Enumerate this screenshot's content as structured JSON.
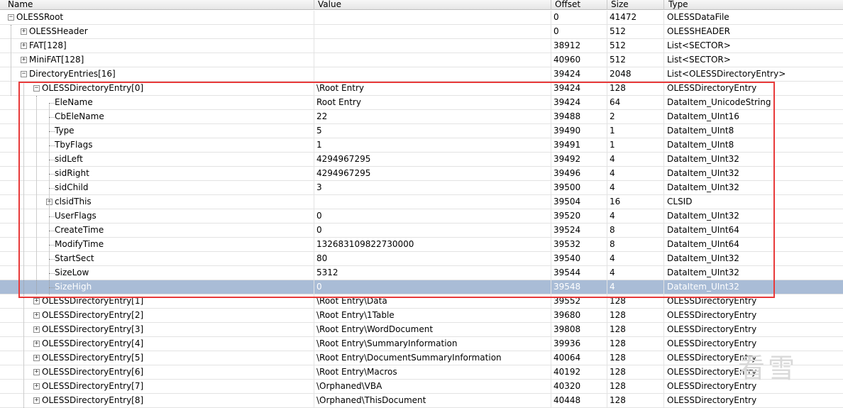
{
  "columns": {
    "name": "Name",
    "value": "Value",
    "offset": "Offset",
    "size": "Size",
    "type": "Type"
  },
  "rows": [
    {
      "name": "OLESSRoot",
      "value": "",
      "offset": "0",
      "size": "41472",
      "type": "OLESSDataFile",
      "level": 0,
      "expander": "-"
    },
    {
      "name": "OLESSHeader",
      "value": "",
      "offset": "0",
      "size": "512",
      "type": "OLESSHEADER",
      "level": 1,
      "expander": "+"
    },
    {
      "name": "FAT[128]",
      "value": "",
      "offset": "38912",
      "size": "512",
      "type": "List<SECTOR>",
      "level": 1,
      "expander": "+"
    },
    {
      "name": "MiniFAT[128]",
      "value": "",
      "offset": "40960",
      "size": "512",
      "type": "List<SECTOR>",
      "level": 1,
      "expander": "+"
    },
    {
      "name": "DirectoryEntries[16]",
      "value": "",
      "offset": "39424",
      "size": "2048",
      "type": "List<OLESSDirectoryEntry>",
      "level": 1,
      "expander": "-"
    },
    {
      "name": "OLESSDirectoryEntry[0]",
      "value": "\\Root Entry",
      "offset": "39424",
      "size": "128",
      "type": "OLESSDirectoryEntry",
      "level": 2,
      "expander": "-"
    },
    {
      "name": "EleName",
      "value": "Root Entry",
      "offset": "39424",
      "size": "64",
      "type": "DataItem_UnicodeString",
      "level": 3,
      "expander": ""
    },
    {
      "name": "CbEleName",
      "value": "22",
      "offset": "39488",
      "size": "2",
      "type": "DataItem_UInt16",
      "level": 3,
      "expander": ""
    },
    {
      "name": "Type",
      "value": "5",
      "offset": "39490",
      "size": "1",
      "type": "DataItem_UInt8",
      "level": 3,
      "expander": ""
    },
    {
      "name": "TbyFlags",
      "value": "1",
      "offset": "39491",
      "size": "1",
      "type": "DataItem_UInt8",
      "level": 3,
      "expander": ""
    },
    {
      "name": "sidLeft",
      "value": "4294967295",
      "offset": "39492",
      "size": "4",
      "type": "DataItem_UInt32",
      "level": 3,
      "expander": ""
    },
    {
      "name": "sidRight",
      "value": "4294967295",
      "offset": "39496",
      "size": "4",
      "type": "DataItem_UInt32",
      "level": 3,
      "expander": ""
    },
    {
      "name": "sidChild",
      "value": "3",
      "offset": "39500",
      "size": "4",
      "type": "DataItem_UInt32",
      "level": 3,
      "expander": ""
    },
    {
      "name": "clsidThis",
      "value": "",
      "offset": "39504",
      "size": "16",
      "type": "CLSID",
      "level": 3,
      "expander": "+"
    },
    {
      "name": "UserFlags",
      "value": "0",
      "offset": "39520",
      "size": "4",
      "type": "DataItem_UInt32",
      "level": 3,
      "expander": ""
    },
    {
      "name": "CreateTime",
      "value": "0",
      "offset": "39524",
      "size": "8",
      "type": "DataItem_UInt64",
      "level": 3,
      "expander": ""
    },
    {
      "name": "ModifyTime",
      "value": "132683109822730000",
      "offset": "39532",
      "size": "8",
      "type": "DataItem_UInt64",
      "level": 3,
      "expander": ""
    },
    {
      "name": "StartSect",
      "value": "80",
      "offset": "39540",
      "size": "4",
      "type": "DataItem_UInt32",
      "level": 3,
      "expander": ""
    },
    {
      "name": "SizeLow",
      "value": "5312",
      "offset": "39544",
      "size": "4",
      "type": "DataItem_UInt32",
      "level": 3,
      "expander": ""
    },
    {
      "name": "SizeHigh",
      "value": "0",
      "offset": "39548",
      "size": "4",
      "type": "DataItem_UInt32",
      "level": 3,
      "expander": "",
      "selected": true
    },
    {
      "name": "OLESSDirectoryEntry[1]",
      "value": "\\Root Entry\\Data",
      "offset": "39552",
      "size": "128",
      "type": "OLESSDirectoryEntry",
      "level": 2,
      "expander": "+"
    },
    {
      "name": "OLESSDirectoryEntry[2]",
      "value": "\\Root Entry\\1Table",
      "offset": "39680",
      "size": "128",
      "type": "OLESSDirectoryEntry",
      "level": 2,
      "expander": "+"
    },
    {
      "name": "OLESSDirectoryEntry[3]",
      "value": "\\Root Entry\\WordDocument",
      "offset": "39808",
      "size": "128",
      "type": "OLESSDirectoryEntry",
      "level": 2,
      "expander": "+"
    },
    {
      "name": "OLESSDirectoryEntry[4]",
      "value": "\\Root Entry\\\u0005SummaryInformation",
      "offset": "39936",
      "size": "128",
      "type": "OLESSDirectoryEntry",
      "level": 2,
      "expander": "+"
    },
    {
      "name": "OLESSDirectoryEntry[5]",
      "value": "\\Root Entry\\\u0005DocumentSummaryInformation",
      "offset": "40064",
      "size": "128",
      "type": "OLESSDirectoryEntry",
      "level": 2,
      "expander": "+"
    },
    {
      "name": "OLESSDirectoryEntry[6]",
      "value": "\\Root Entry\\Macros",
      "offset": "40192",
      "size": "128",
      "type": "OLESSDirectoryEntry",
      "level": 2,
      "expander": "+"
    },
    {
      "name": "OLESSDirectoryEntry[7]",
      "value": "\\Orphaned\\VBA",
      "offset": "40320",
      "size": "128",
      "type": "OLESSDirectoryEntry",
      "level": 2,
      "expander": "+"
    },
    {
      "name": "OLESSDirectoryEntry[8]",
      "value": "\\Orphaned\\ThisDocument",
      "offset": "40448",
      "size": "128",
      "type": "OLESSDirectoryEntry",
      "level": 2,
      "expander": "+"
    }
  ],
  "watermark": "看雪",
  "colors": {
    "selection": "#a9bcd6",
    "highlight_box": "#e83a3a"
  }
}
